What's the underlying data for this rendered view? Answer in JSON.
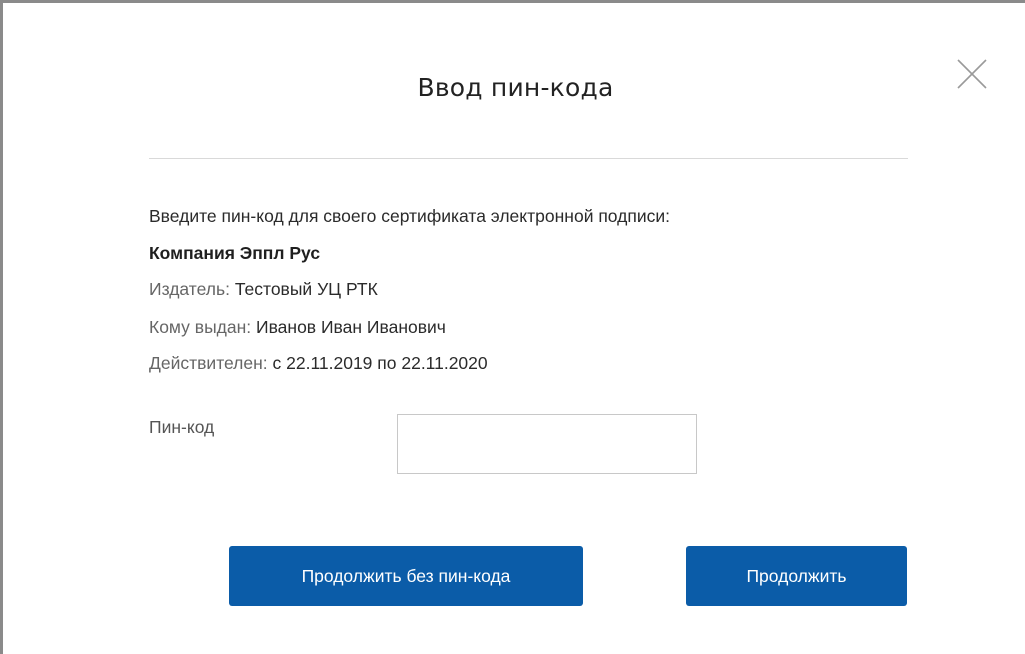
{
  "dialog": {
    "title": "Ввод пин-кода",
    "close_icon": "close-icon"
  },
  "certificate": {
    "prompt": "Введите пин-код для своего сертификата электронной подписи:",
    "company": "Компания Эппл Рус",
    "issuer_label": "Издатель:",
    "issuer_value": "Тестовый УЦ РТК",
    "issued_to_label": "Кому выдан:",
    "issued_to_value": "Иванов Иван Иванович",
    "valid_label": "Действителен:",
    "valid_value": "с 22.11.2019 по 22.11.2020"
  },
  "pin": {
    "label": "Пин-код",
    "value": "",
    "placeholder": ""
  },
  "buttons": {
    "continue_without_pin": "Продолжить без пин-кода",
    "continue": "Продолжить"
  },
  "colors": {
    "button_bg": "#0b5ca8",
    "button_text": "#ffffff"
  }
}
